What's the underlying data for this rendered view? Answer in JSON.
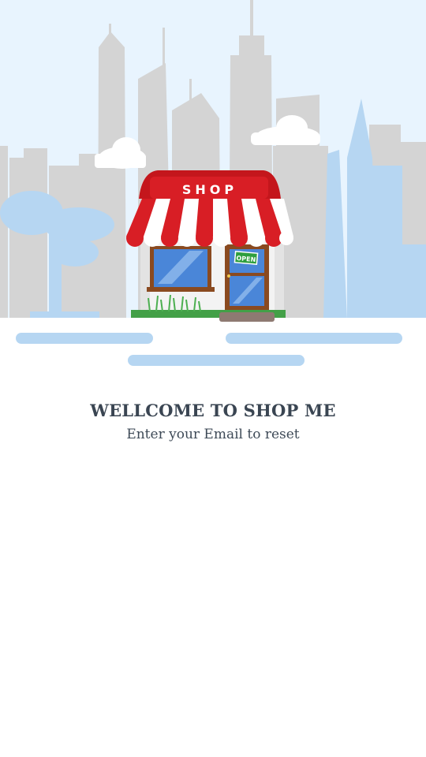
{
  "illustration": {
    "sign_text": "SHOP",
    "door_sign_text": "OPEN",
    "icon": "storefront-icon"
  },
  "colors": {
    "sky": "#e8f4fe",
    "skyline": "#d4d4d4",
    "skyline_blue": "#b6d6f2",
    "awning_red": "#d81e25",
    "awning_white": "#ffffff",
    "grass": "#4caf50",
    "title_text": "#3a4552"
  },
  "welcome": {
    "title": "WELLCOME TO SHOP ME",
    "subtitle": "Enter your Email to reset"
  }
}
